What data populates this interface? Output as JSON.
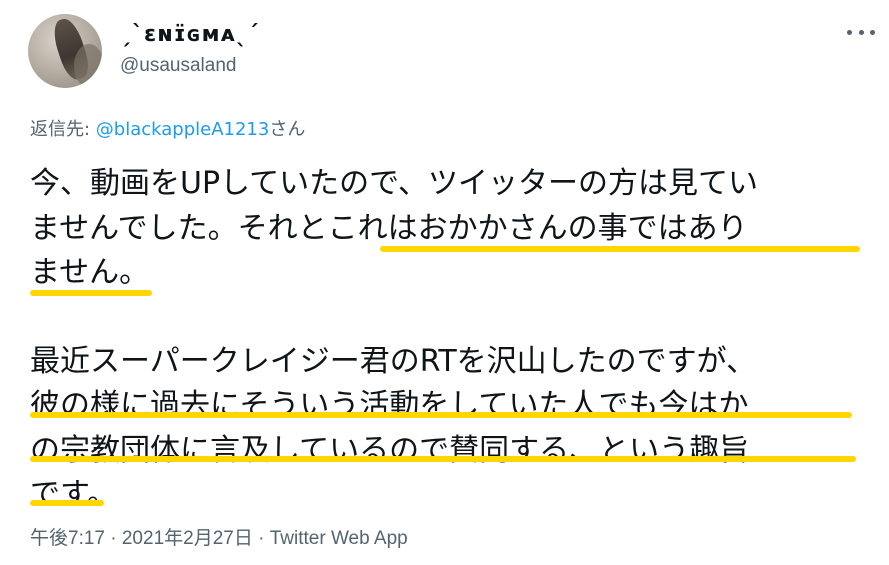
{
  "author": {
    "display_name": "ˏˋɛɴɪ̈ɢᴍᴀˎˊ",
    "handle": "@usausaland"
  },
  "reply": {
    "prefix": "返信先: ",
    "mention": "@blackappleA1213",
    "suffix": "さん"
  },
  "body": {
    "lines": [
      "今、動画をUPしていたので、ツイッターの方は見てい",
      "ませんでした。それとこれはおかかさんの事ではあり",
      "ません。",
      "最近スーパークレイジー君のRTを沢山したのですが、",
      "彼の様に過去にそういう活動をしていた人でも今はか",
      "の宗教団体に言及しているので賛同する、という趣旨",
      "です。"
    ]
  },
  "meta": {
    "timestamp": "午後7:17 · 2021年2月27日 · Twitter Web App"
  },
  "colors": {
    "highlight": "#ffd600",
    "link": "#1d9bf0",
    "secondary_text": "#536471"
  },
  "icons": {
    "more": "more-horizontal-icon"
  }
}
